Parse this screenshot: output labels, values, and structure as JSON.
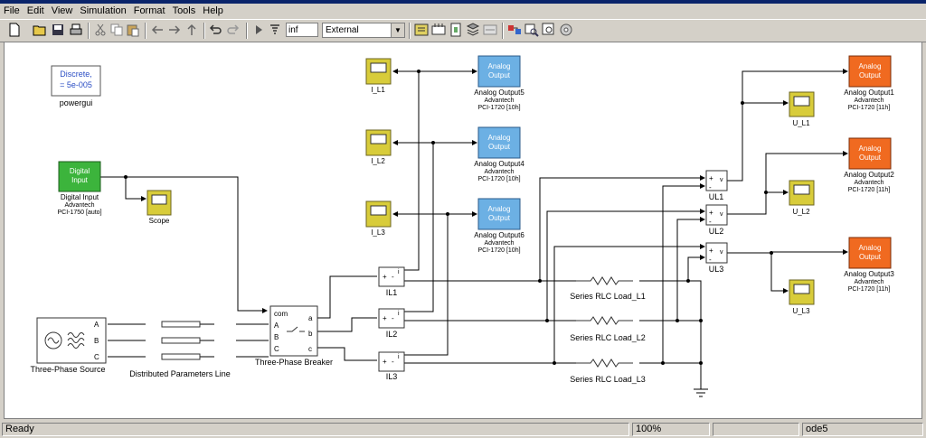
{
  "menu": [
    "File",
    "Edit",
    "View",
    "Simulation",
    "Format",
    "Tools",
    "Help"
  ],
  "toolbar": {
    "stop_time": "inf",
    "sim_mode": "External",
    "icons": [
      "new-icon",
      "open-icon",
      "save-icon",
      "print-icon",
      "cut-icon",
      "copy-icon",
      "paste-icon",
      "back-icon",
      "forward-icon",
      "up-icon",
      "undo-icon",
      "redo-icon",
      "start-icon",
      "build-icon",
      "library-icon",
      "model-browser-icon",
      "debugger-icon",
      "explorer-icon",
      "diagnostics-icon",
      "connect-icon",
      "find-icon",
      "zoom-icon",
      "settings-icon"
    ]
  },
  "blocks": {
    "powergui": {
      "line1": "Discrete,",
      "line2": "= 5e-005",
      "name": "powergui"
    },
    "digital_input": {
      "text1": "Digital",
      "text2": "Input",
      "name1": "Digital Input",
      "name2": "Advantech",
      "name3": "PCI-1750 [auto]"
    },
    "scope": {
      "name": "Scope"
    },
    "source": {
      "name": "Three-Phase Source",
      "ports": [
        "A",
        "B",
        "C"
      ]
    },
    "line": {
      "name": "Distributed Parameters Line"
    },
    "breaker": {
      "name": "Three-Phase Breaker",
      "com": "com",
      "a": "a",
      "b": "b",
      "c": "c",
      "A": "A",
      "B": "B",
      "C": "C"
    },
    "il": [
      {
        "name": "IL1"
      },
      {
        "name": "IL2"
      },
      {
        "name": "IL3"
      }
    ],
    "i_scopes": [
      {
        "name": "I_L1"
      },
      {
        "name": "I_L2"
      },
      {
        "name": "I_L3"
      }
    ],
    "analog_blue": [
      {
        "text1": "Analog",
        "text2": "Output",
        "name1": "Analog Output5",
        "name2": "Advantech",
        "name3": "PCI-1720 [10h]"
      },
      {
        "text1": "Analog",
        "text2": "Output",
        "name1": "Analog Output4",
        "name2": "Advantech",
        "name3": "PCI-1720 [10h]"
      },
      {
        "text1": "Analog",
        "text2": "Output",
        "name1": "Analog Output6",
        "name2": "Advantech",
        "name3": "PCI-1720 [10h]"
      }
    ],
    "rlc": [
      {
        "name": "Series RLC Load_L1"
      },
      {
        "name": "Series RLC Load_L2"
      },
      {
        "name": "Series RLC Load_L3"
      }
    ],
    "ul": [
      {
        "name": "UL1"
      },
      {
        "name": "UL2"
      },
      {
        "name": "UL3"
      }
    ],
    "u_scopes": [
      {
        "name": "U_L1"
      },
      {
        "name": "U_L2"
      },
      {
        "name": "U_L3"
      }
    ],
    "analog_orange": [
      {
        "text1": "Analog",
        "text2": "Output",
        "name1": "Analog Output1",
        "name2": "Advantech",
        "name3": "PCI-1720 [11h]"
      },
      {
        "text1": "Analog",
        "text2": "Output",
        "name1": "Analog Output2",
        "name2": "Advantech",
        "name3": "PCI-1720 [11h]"
      },
      {
        "text1": "Analog",
        "text2": "Output",
        "name1": "Analog Output3",
        "name2": "Advantech",
        "name3": "PCI-1720 [11h]"
      }
    ],
    "meas_signs": {
      "plus": "+",
      "minus": "-",
      "i": "i",
      "v": "v"
    }
  },
  "status": {
    "ready": "Ready",
    "zoom": "100%",
    "solver": "ode5"
  },
  "colors": {
    "scope": "#d8cc3a",
    "green": "#3cb43c",
    "blue": "#6cb0e4",
    "orange": "#f06a20"
  }
}
